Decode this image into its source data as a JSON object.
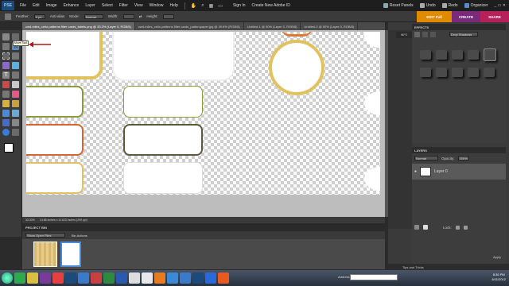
{
  "app": {
    "logo": "PSE"
  },
  "menu": [
    "File",
    "Edit",
    "Image",
    "Enhance",
    "Layer",
    "Select",
    "Filter",
    "View",
    "Window",
    "Help"
  ],
  "menu_right": {
    "signin": "Sign In",
    "create_id": "Create New Adobe ID",
    "reset": "Reset Panels",
    "undo": "Undo",
    "redo": "Redo",
    "organizer": "Organizer"
  },
  "options": {
    "feather_label": "Feather:",
    "feather_value": "0 px",
    "antialias": "Anti-alias",
    "mode_label": "Mode:",
    "mode_value": "Normal",
    "width_label": "Width:",
    "height_label": "Height:"
  },
  "modes": {
    "edit": "EDIT Full",
    "create": "CREATE",
    "share": "SHARE"
  },
  "tabs": [
    "cwd-miles_ceiio patterns filter cards_labels.png @ 33.3% (Layer 0, RGB/8)",
    "cwd-miles_ceiio patterns filter cards_patternpaper.jpg @ 49.6% (RGB/8)",
    "Untitled-1 @ 50% (Layer 0, RGB/8)",
    "Untitled-2 @ 50% (Layer 0, RGB/8)"
  ],
  "tooltip": "Move Tool (V)",
  "status": {
    "zoom": "33.33%",
    "dims": "14.86 inches x 11.623 inches (299 ppi)"
  },
  "effects": {
    "title": "EFFECTS",
    "filter": "Drop Shadows"
  },
  "layers": {
    "title": "LAYERS",
    "blend": "Normal",
    "opacity_label": "Opacity:",
    "opacity": "100%",
    "layer_name": "Layer 0",
    "lock": "Lock:"
  },
  "panel_strip": {
    "info": "INFO"
  },
  "project_bin": {
    "title": "PROJECT BIN",
    "show": "Show Open Files",
    "actions": "Bin Actions"
  },
  "tips": "Tips and Tricks",
  "taskbar": {
    "address_label": "Address",
    "time": "8:36 PM",
    "date": "6/11/2012"
  },
  "colors": {
    "gold": "#e2c15f",
    "olive": "#8c9a3a",
    "rust": "#d9632b",
    "dark_olive": "#5a5a3a",
    "orange_arc": "#e07830"
  }
}
